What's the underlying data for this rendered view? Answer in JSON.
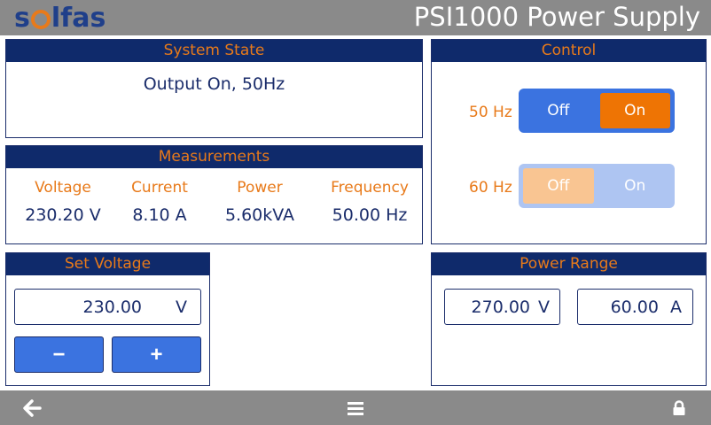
{
  "header": {
    "logo_text_1": "s",
    "logo_text_2": "lfas",
    "title": "PSI1000 Power Supply"
  },
  "system_state": {
    "heading": "System State",
    "text": "Output On, 50Hz"
  },
  "measurements": {
    "heading": "Measurements",
    "columns": [
      {
        "label": "Voltage",
        "value": "230.20 V"
      },
      {
        "label": "Current",
        "value": "8.10 A"
      },
      {
        "label": "Power",
        "value": "5.60kVA"
      },
      {
        "label": "Frequency",
        "value": "50.00 Hz"
      }
    ]
  },
  "set_voltage": {
    "heading": "Set Voltage",
    "value": "230.00",
    "unit": "V",
    "minus_label": "−",
    "plus_label": "+"
  },
  "control": {
    "heading": "Control",
    "rows": [
      {
        "label": "50 Hz",
        "off": "Off",
        "on": "On",
        "state": "on"
      },
      {
        "label": "60 Hz",
        "off": "Off",
        "on": "On",
        "state": "off"
      }
    ]
  },
  "power_range": {
    "heading": "Power Range",
    "voltage_value": "270.00",
    "voltage_unit": "V",
    "current_value": "60.00",
    "current_unit": "A"
  },
  "footer": {
    "back_icon": "arrow-left-icon",
    "menu_icon": "hamburger-menu-icon",
    "lock_icon": "lock-icon"
  },
  "colors": {
    "header_bg": "#8a8a8a",
    "panel_head_bg": "#0f2a6b",
    "accent_orange": "#ee7404",
    "button_blue": "#3b73e0",
    "text_navy": "#1b2d6b"
  }
}
